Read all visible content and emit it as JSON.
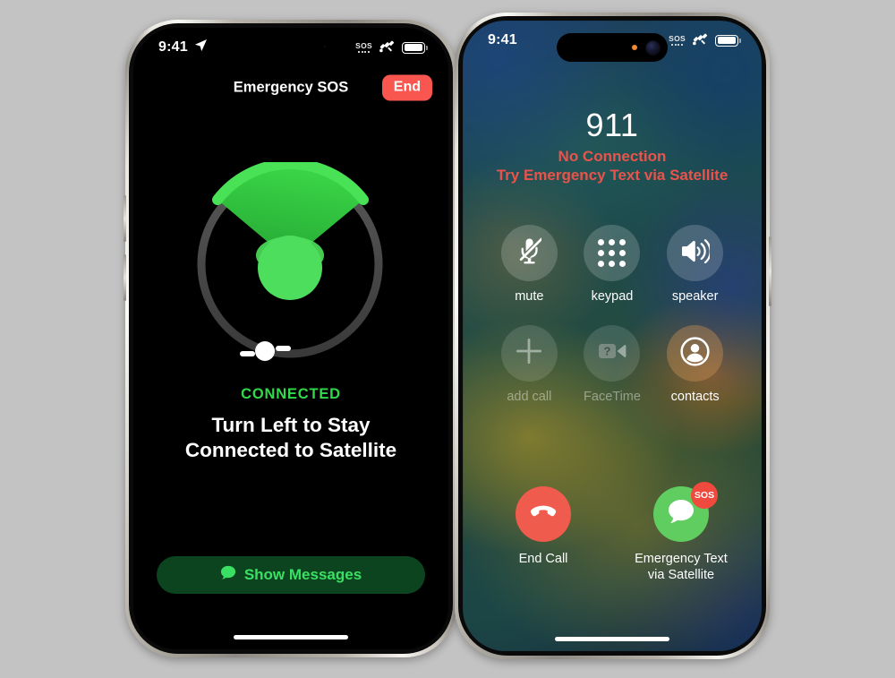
{
  "page": {
    "background_color": "#c3c3c3"
  },
  "left_phone": {
    "name": "emergency-sos-satellite-pointer-screen",
    "status_bar": {
      "time": "9:41",
      "location_icon": "location-arrow-icon",
      "sos_icon": "sos-signal-icon",
      "sos_label": "SOS",
      "satellite_icon": "satellite-icon",
      "battery_icon": "battery-full-icon"
    },
    "nav": {
      "title": "Emergency SOS",
      "end_button": "End"
    },
    "pointer": {
      "icon": "satellite-direction-pointer",
      "cone_color": "#2eb83a",
      "cone_edge_color": "#44e056",
      "dot_color": "#4ede5e",
      "ring_color": "#4a4a4a",
      "marker_color": "#ffffff"
    },
    "status": {
      "connection_state": "CONNECTED",
      "connection_color": "#31d94a",
      "instruction_line1": "Turn Left to Stay",
      "instruction_line2": "Connected to Satellite"
    },
    "show_messages_button": {
      "label": "Show Messages",
      "icon": "message-bubble-icon",
      "background_color": "#0c4420",
      "text_color": "#3ae063"
    }
  },
  "right_phone": {
    "name": "emergency-911-call-screen",
    "status_bar": {
      "time": "9:41",
      "sos_icon": "sos-signal-icon",
      "sos_label": "SOS",
      "satellite_icon": "satellite-icon",
      "battery_icon": "battery-full-icon"
    },
    "call": {
      "number": "911",
      "status_line1": "No Connection",
      "status_line2": "Try Emergency Text via Satellite",
      "status_color": "#e8544b"
    },
    "controls": [
      {
        "label": "mute",
        "icon": "microphone-muted-icon",
        "state": "active"
      },
      {
        "label": "keypad",
        "icon": "keypad-dots-icon",
        "state": "active"
      },
      {
        "label": "speaker",
        "icon": "speaker-waves-icon",
        "state": "active"
      },
      {
        "label": "add call",
        "icon": "plus-icon",
        "state": "disabled"
      },
      {
        "label": "FaceTime",
        "icon": "facetime-video-unavailable-icon",
        "state": "disabled"
      },
      {
        "label": "contacts",
        "icon": "contact-person-icon",
        "state": "active"
      }
    ],
    "actions": [
      {
        "label": "End Call",
        "icon": "end-call-handset-icon",
        "color": "#ef5b4c",
        "badge": null
      },
      {
        "label": "Emergency Text\nvia Satellite",
        "label_line1": "Emergency Text",
        "label_line2": "via Satellite",
        "icon": "message-bubble-icon",
        "color": "#5fcd60",
        "badge": "SOS",
        "badge_color": "#ef4a3d"
      }
    ]
  }
}
